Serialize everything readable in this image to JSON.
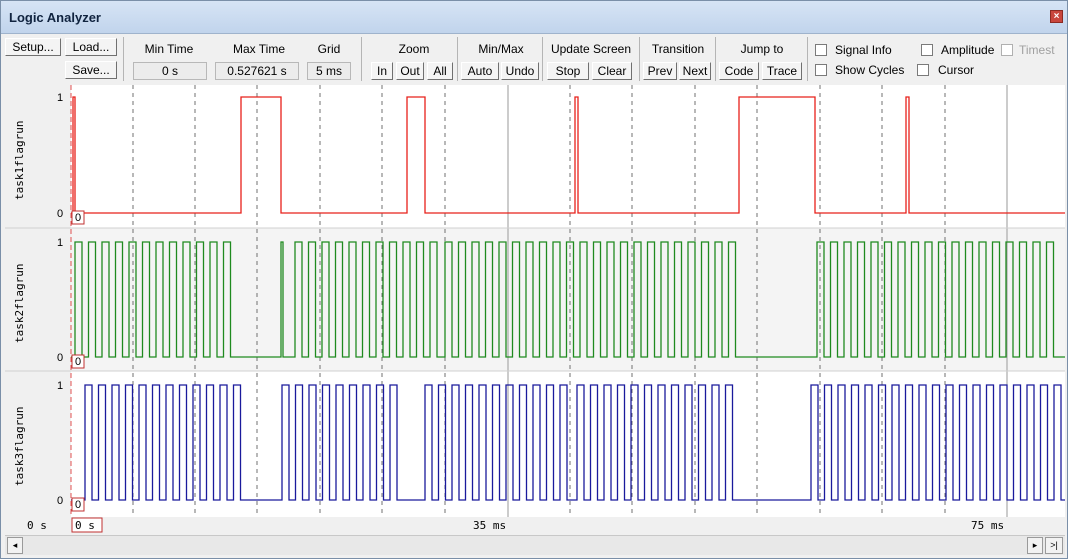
{
  "window": {
    "title": "Logic Analyzer"
  },
  "toolbar": {
    "setup": "Setup...",
    "load": "Load...",
    "save": "Save...",
    "min_time_label": "Min Time",
    "min_time_value": "0 s",
    "max_time_label": "Max Time",
    "max_time_value": "0.527621 s",
    "grid_label": "Grid",
    "grid_value": "5 ms",
    "zoom_label": "Zoom",
    "zoom_in": "In",
    "zoom_out": "Out",
    "zoom_all": "All",
    "minmax_label": "Min/Max",
    "auto": "Auto",
    "undo": "Undo",
    "update_label": "Update Screen",
    "stop": "Stop",
    "clear": "Clear",
    "transition_label": "Transition",
    "prev": "Prev",
    "next": "Next",
    "jumpto_label": "Jump to",
    "code": "Code",
    "trace": "Trace",
    "signal_info": "Signal Info",
    "show_cycles": "Show Cycles",
    "amplitude": "Amplitude",
    "cursor": "Cursor",
    "timestamps": "Timest"
  },
  "signals": [
    {
      "name": "task1flagrun",
      "color": "#e8201a",
      "high_label": "1",
      "low_label": "0",
      "marker": "0"
    },
    {
      "name": "task2flagrun",
      "color": "#1f8a1f",
      "high_label": "1",
      "low_label": "0",
      "marker": "0"
    },
    {
      "name": "task3flagrun",
      "color": "#1a1a9c",
      "high_label": "1",
      "low_label": "0",
      "marker": "0"
    }
  ],
  "time_axis": {
    "left_label": "0 s",
    "start_marker": "0 s",
    "mid_label": "35 ms",
    "right_label": "75 ms"
  },
  "scroll": {
    "left": "◂",
    "right": "▸",
    "end": ">|"
  }
}
